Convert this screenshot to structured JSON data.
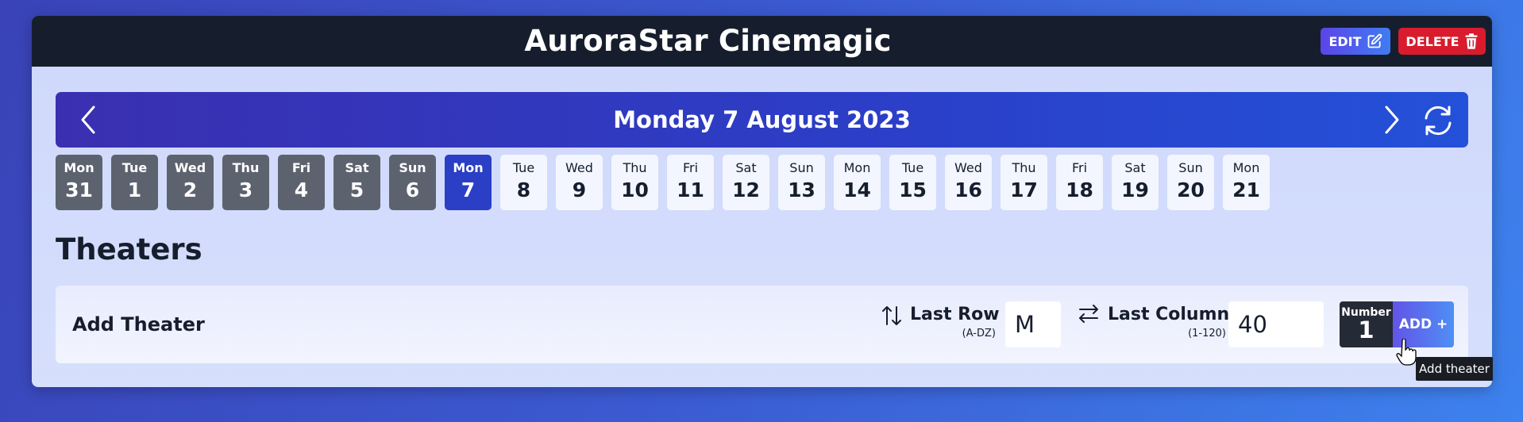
{
  "header": {
    "title": "AuroraStar Cinemagic",
    "edit_label": "EDIT",
    "delete_label": "DELETE"
  },
  "date_nav": {
    "title": "Monday 7 August 2023",
    "days": [
      {
        "name": "Mon",
        "num": "31",
        "state": "past"
      },
      {
        "name": "Tue",
        "num": "1",
        "state": "past"
      },
      {
        "name": "Wed",
        "num": "2",
        "state": "past"
      },
      {
        "name": "Thu",
        "num": "3",
        "state": "past"
      },
      {
        "name": "Fri",
        "num": "4",
        "state": "past"
      },
      {
        "name": "Sat",
        "num": "5",
        "state": "past"
      },
      {
        "name": "Sun",
        "num": "6",
        "state": "past"
      },
      {
        "name": "Mon",
        "num": "7",
        "state": "current"
      },
      {
        "name": "Tue",
        "num": "8",
        "state": "future"
      },
      {
        "name": "Wed",
        "num": "9",
        "state": "future"
      },
      {
        "name": "Thu",
        "num": "10",
        "state": "future"
      },
      {
        "name": "Fri",
        "num": "11",
        "state": "future"
      },
      {
        "name": "Sat",
        "num": "12",
        "state": "future"
      },
      {
        "name": "Sun",
        "num": "13",
        "state": "future"
      },
      {
        "name": "Mon",
        "num": "14",
        "state": "future"
      },
      {
        "name": "Tue",
        "num": "15",
        "state": "future"
      },
      {
        "name": "Wed",
        "num": "16",
        "state": "future"
      },
      {
        "name": "Thu",
        "num": "17",
        "state": "future"
      },
      {
        "name": "Fri",
        "num": "18",
        "state": "future"
      },
      {
        "name": "Sat",
        "num": "19",
        "state": "future"
      },
      {
        "name": "Sun",
        "num": "20",
        "state": "future"
      },
      {
        "name": "Mon",
        "num": "21",
        "state": "future"
      }
    ]
  },
  "theaters": {
    "section_title": "Theaters",
    "add_label": "Add Theater",
    "last_row_label": "Last Row :",
    "last_row_hint": "(A-DZ)",
    "last_row_value": "M",
    "last_column_label": "Last Column :",
    "last_column_hint": "(1-120)",
    "last_column_value": "40",
    "number_label": "Number",
    "number_value": "1",
    "add_button_label": "ADD +",
    "tooltip": "Add theater"
  },
  "colors": {
    "topbar": "#161e2e",
    "accent": "#2a3fc6",
    "delete": "#d81c2d",
    "past_day": "#5d636e"
  }
}
